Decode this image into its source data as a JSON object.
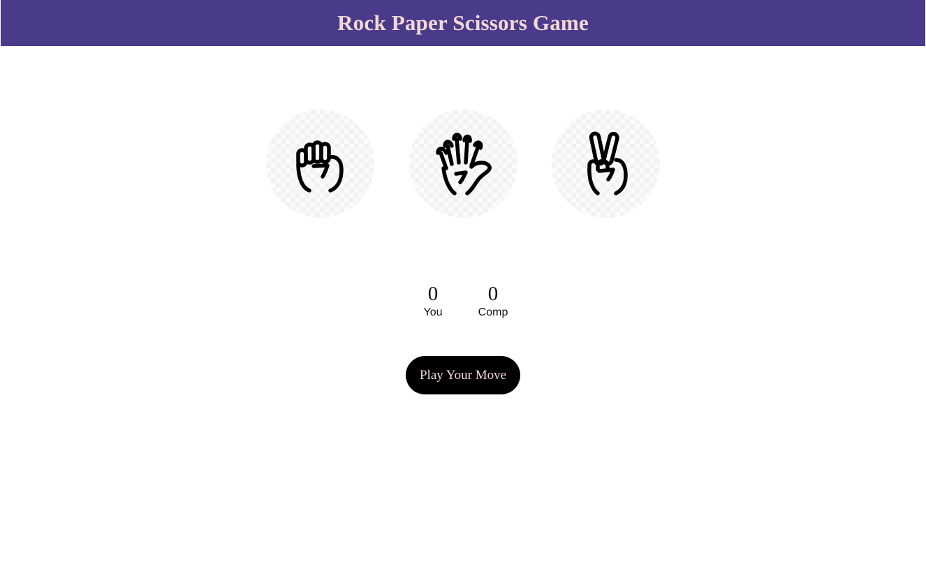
{
  "header": {
    "title": "Rock Paper Scissors Game",
    "background_color": "#4a3b8a",
    "title_color": "#f3d9d6"
  },
  "choices": [
    {
      "id": "rock",
      "icon": "rock-fist-icon"
    },
    {
      "id": "paper",
      "icon": "paper-open-hand-icon"
    },
    {
      "id": "scissors",
      "icon": "scissors-victory-hand-icon"
    }
  ],
  "scoreboard": {
    "user_score": "0",
    "user_label": "You",
    "comp_score": "0",
    "comp_label": "Comp"
  },
  "message": {
    "text": "Play Your Move",
    "background_color": "#000000",
    "text_color": "#f3d9d6"
  }
}
